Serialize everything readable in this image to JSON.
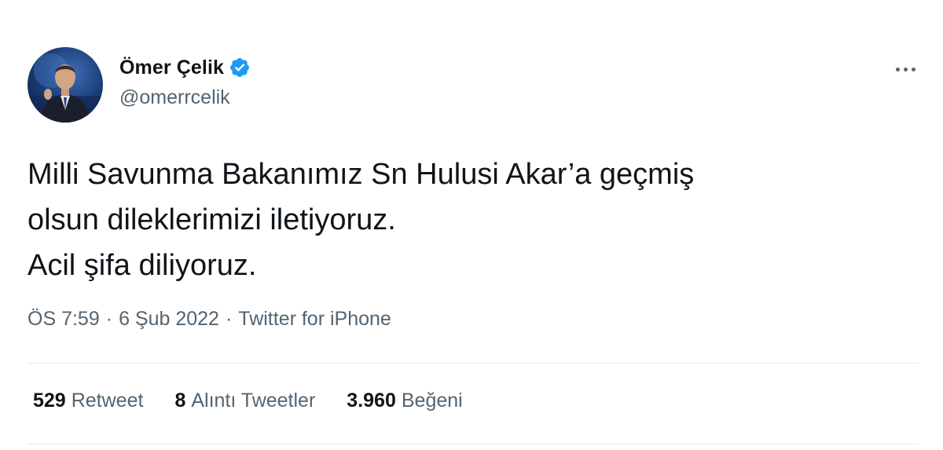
{
  "tweet": {
    "author": {
      "name": "Ömer Çelik",
      "handle": "@omerrcelik",
      "verified": true,
      "verified_color": "#1d9bf0"
    },
    "text_lines": [
      "Milli Savunma Bakanımız Sn Hulusi Akar’a geçmiş",
      "olsun dileklerimizi iletiyoruz.",
      "Acil şifa diliyoruz."
    ],
    "time": "ÖS 7:59",
    "date": "6 Şub 2022",
    "separator": "·",
    "source": "Twitter for iPhone",
    "stats": {
      "retweets": {
        "count": "529",
        "label": "Retweet"
      },
      "quotes": {
        "count": "8",
        "label": "Alıntı Tweetler"
      },
      "likes": {
        "count": "3.960",
        "label": "Beğeni"
      }
    }
  },
  "icons": {
    "more": "more-options-icon",
    "verified": "verified-badge-icon"
  },
  "colors": {
    "text_primary": "#0f1419",
    "text_secondary": "#536471",
    "divider": "#e6ebee",
    "accent": "#1d9bf0"
  }
}
